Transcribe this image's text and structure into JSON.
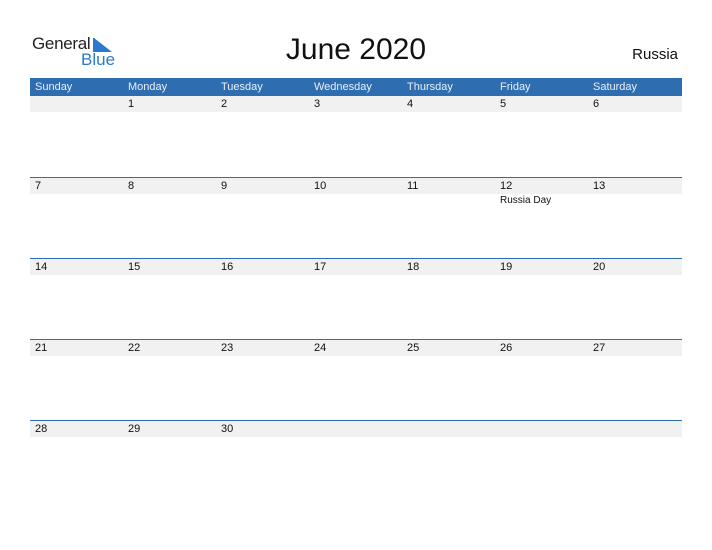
{
  "logo": {
    "word1": "General",
    "word2": "Blue"
  },
  "title": "June 2020",
  "country": "Russia",
  "colors": {
    "header": "#2e6db0",
    "accent": "#2a7ad0",
    "strip": "#f1f1f1"
  },
  "weekdays": [
    "Sunday",
    "Monday",
    "Tuesday",
    "Wednesday",
    "Thursday",
    "Friday",
    "Saturday"
  ],
  "weeks": [
    {
      "days": [
        "",
        "1",
        "2",
        "3",
        "4",
        "5",
        "6"
      ],
      "events": [
        "",
        "",
        "",
        "",
        "",
        "",
        ""
      ]
    },
    {
      "days": [
        "7",
        "8",
        "9",
        "10",
        "11",
        "12",
        "13"
      ],
      "events": [
        "",
        "",
        "",
        "",
        "",
        "Russia Day",
        ""
      ]
    },
    {
      "days": [
        "14",
        "15",
        "16",
        "17",
        "18",
        "19",
        "20"
      ],
      "events": [
        "",
        "",
        "",
        "",
        "",
        "",
        ""
      ]
    },
    {
      "days": [
        "21",
        "22",
        "23",
        "24",
        "25",
        "26",
        "27"
      ],
      "events": [
        "",
        "",
        "",
        "",
        "",
        "",
        ""
      ]
    },
    {
      "days": [
        "28",
        "29",
        "30",
        "",
        "",
        "",
        ""
      ],
      "events": [
        "",
        "",
        "",
        "",
        "",
        "",
        ""
      ]
    }
  ]
}
